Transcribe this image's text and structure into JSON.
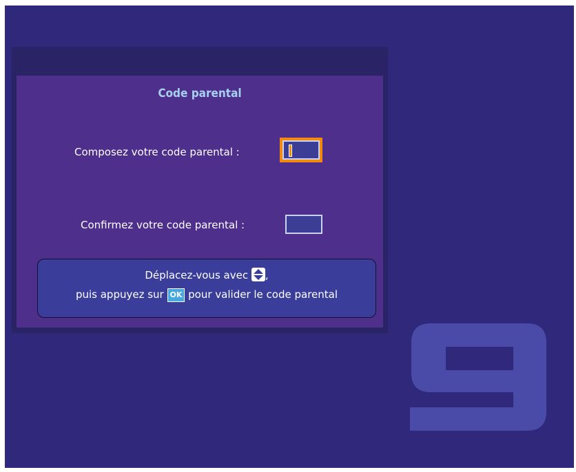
{
  "dialog": {
    "title": "Code parental",
    "compose_label": "Composez votre code parental :",
    "confirm_label": "Confirmez votre code parental :",
    "compose_value": "",
    "confirm_value": ""
  },
  "help": {
    "line1_text": "Déplacez-vous avec",
    "line1_suffix": ",",
    "line2_prefix": "puis appuyez sur",
    "ok_key": "OK",
    "line2_suffix": "pour valider le code parental",
    "arrows_icon": "up-down-arrows-icon"
  },
  "logo": {
    "icon": "channel-9-logo-icon",
    "text": "9"
  },
  "colors": {
    "background": "#30287a",
    "panel": "#4e2f8c",
    "focus": "#f08a10",
    "title": "#a7cff0"
  }
}
